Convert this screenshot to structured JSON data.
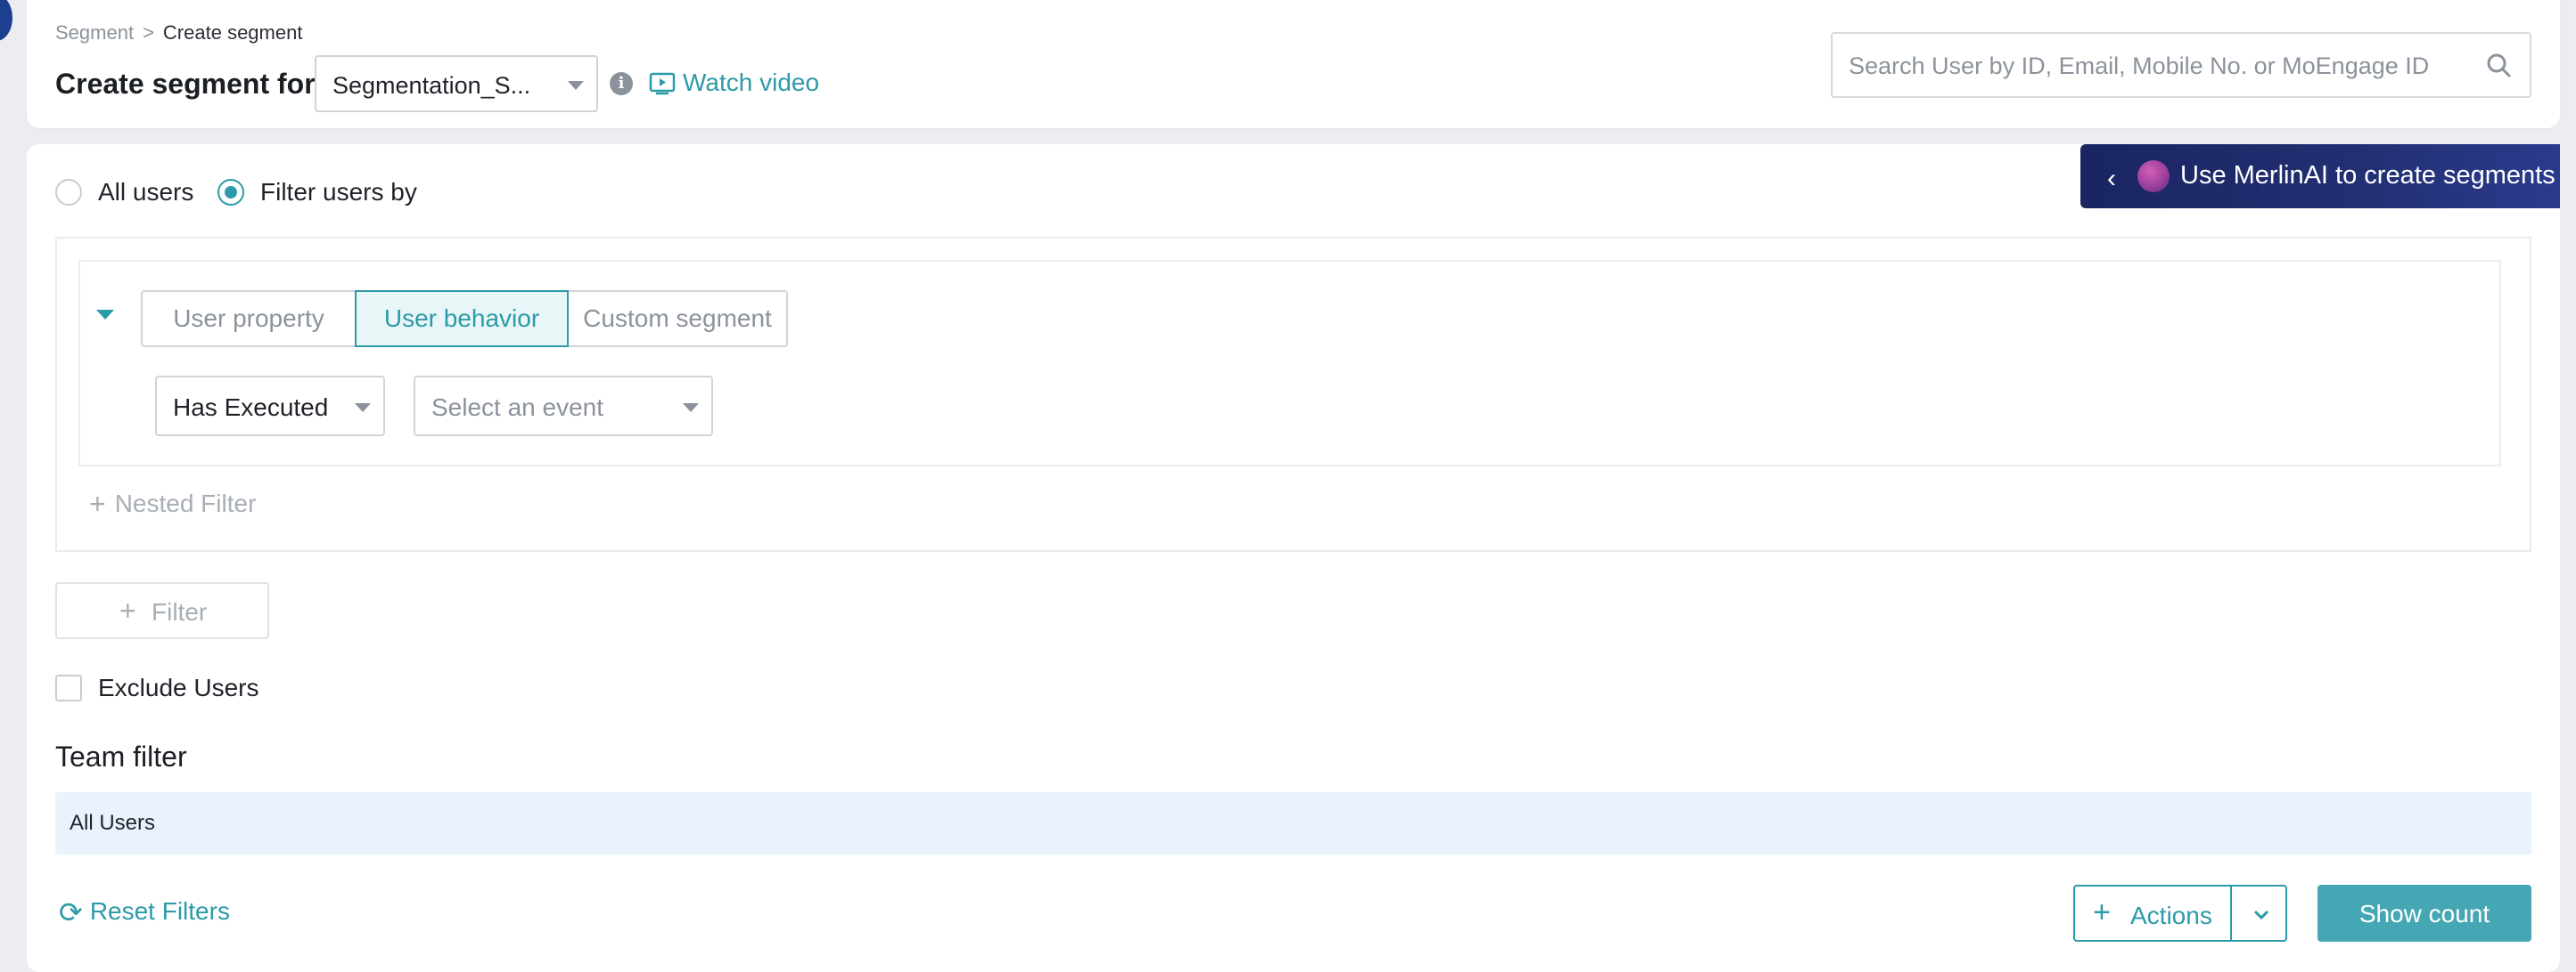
{
  "breadcrumb": {
    "parent": "Segment",
    "separator": ">",
    "current": "Create segment"
  },
  "header": {
    "title": "Create segment for",
    "segment_select_value": "Segmentation_S...",
    "watch_video_label": "Watch video",
    "search_placeholder": "Search User by ID, Email, Mobile No. or MoEngage ID"
  },
  "audience": {
    "all_users_label": "All users",
    "filter_users_label": "Filter users by",
    "selected": "Filter users by"
  },
  "merlin": {
    "label": "Use MerlinAI to create segments"
  },
  "filter_tabs": [
    {
      "label": "User property",
      "active": false
    },
    {
      "label": "User behavior",
      "active": true
    },
    {
      "label": "Custom segment",
      "active": false
    }
  ],
  "condition": {
    "executed_value": "Has Executed",
    "event_placeholder": "Select an event"
  },
  "nested_filter_label": "Nested Filter",
  "add_filter_label": "Filter",
  "exclude_users_label": "Exclude Users",
  "team_filter": {
    "title": "Team filter",
    "value": "All Users"
  },
  "footer": {
    "reset_label": "Reset Filters",
    "actions_label": "Actions",
    "show_count_label": "Show count"
  },
  "colors": {
    "accent": "#2c9aa8",
    "merlin_bg": "#1a2562",
    "team_row_bg": "#eaf3fd"
  },
  "icons": [
    "info-icon",
    "video-icon",
    "search-icon",
    "chevron-left-icon",
    "merlin-orb-icon",
    "caret-down-icon",
    "plus-icon",
    "refresh-icon",
    "chevron-down-icon"
  ]
}
